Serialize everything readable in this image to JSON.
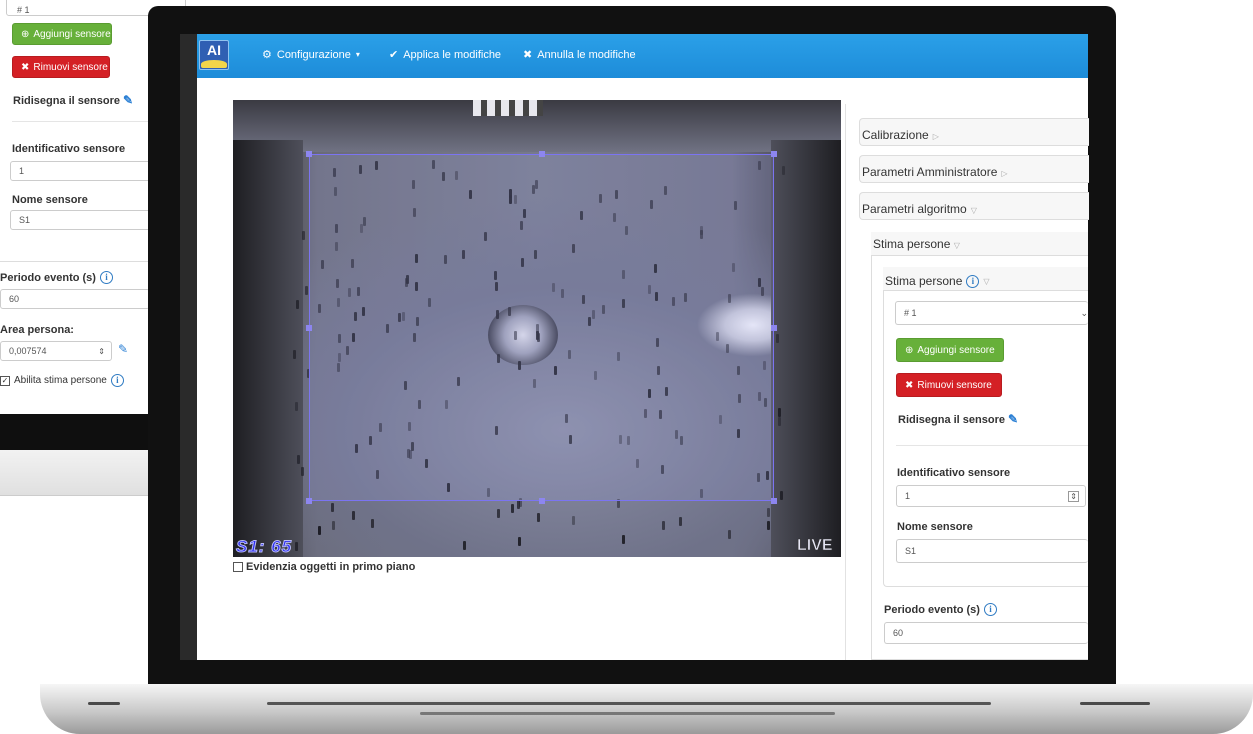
{
  "bg_panel": {
    "select_value": "# 1",
    "add_label": "Aggiungi sensore",
    "remove_label": "Rimuovi sensore",
    "redraw_label": "Ridisegna il sensore",
    "id_label": "Identificativo sensore",
    "id_value": "1",
    "name_label": "Nome sensore",
    "name_value": "S1",
    "period_label": "Periodo evento (s)",
    "period_value": "60",
    "area_label": "Area persona:",
    "area_value": "0,007574",
    "enable_label": "Abilita stima persone"
  },
  "navbar": {
    "logo": "AI",
    "config_label": "Configurazione",
    "apply_label": "Applica le modifiche",
    "cancel_label": "Annulla le modifiche"
  },
  "video": {
    "camera_label": "S1: 65",
    "live_label": "LIVE",
    "highlight_label": "Evidenzia oggetti in primo piano"
  },
  "panel": {
    "calibration": "Calibrazione",
    "admin": "Parametri Amministratore",
    "algorithm": "Parametri algoritmo",
    "people_group": "Stima persone",
    "people_sub": "Stima persone",
    "select_value": "# 1",
    "add_label": "Aggiungi sensore",
    "remove_label": "Rimuovi sensore",
    "redraw_label": "Ridisegna il sensore",
    "id_label": "Identificativo sensore",
    "id_value": "1",
    "name_label": "Nome sensore",
    "name_value": "S1",
    "period_label": "Periodo evento (s)",
    "period_value": "60"
  },
  "colors": {
    "navbar": "#1d8cd9",
    "add_button": "#67b03a",
    "remove_button": "#d42025",
    "roi_border": "#7b74f2"
  }
}
